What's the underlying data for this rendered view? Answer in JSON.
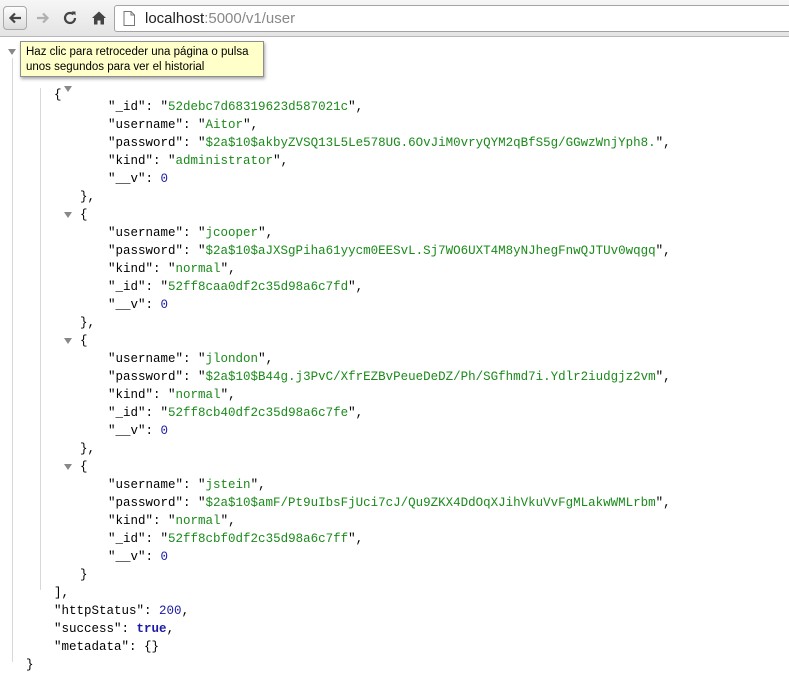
{
  "browser": {
    "url_host": "localhost",
    "url_path": ":5000/v1/user",
    "tooltip_line1": "Haz clic para retroceder una página o pulsa",
    "tooltip_line2": "unos segundos para ver el historial"
  },
  "users": [
    {
      "_id": "52debc7d68319623d587021c",
      "username": "Aitor",
      "password": "$2a$10$akbyZVSQ13L5Le578UG.6OvJiM0vryQYM2qBfS5g/GGwzWnjYph8.",
      "kind": "administrator",
      "__v": "0"
    },
    {
      "username": "jcooper",
      "password": "$2a$10$aJXSgPiha61yycm0EESvL.Sj7WO6UXT4M8yNJhegFnwQJTUv0wqgq",
      "kind": "normal",
      "_id": "52ff8caa0df2c35d98a6c7fd",
      "__v": "0"
    },
    {
      "username": "jlondon",
      "password": "$2a$10$B44g.j3PvC/XfrEZBvPeueDeDZ/Ph/SGfhmd7i.Ydlr2iudgjz2vm",
      "kind": "normal",
      "_id": "52ff8cb40df2c35d98a6c7fe",
      "__v": "0"
    },
    {
      "username": "jstein",
      "password": "$2a$10$amF/Pt9uIbsFjUci7cJ/Qu9ZKX4DdOqXJihVkuVvFgMLakwWMLrbm",
      "kind": "normal",
      "_id": "52ff8cbf0df2c35d98a6c7ff",
      "__v": "0"
    }
  ],
  "footer": {
    "httpStatus": "200",
    "success": "true",
    "metadata": "{}"
  }
}
